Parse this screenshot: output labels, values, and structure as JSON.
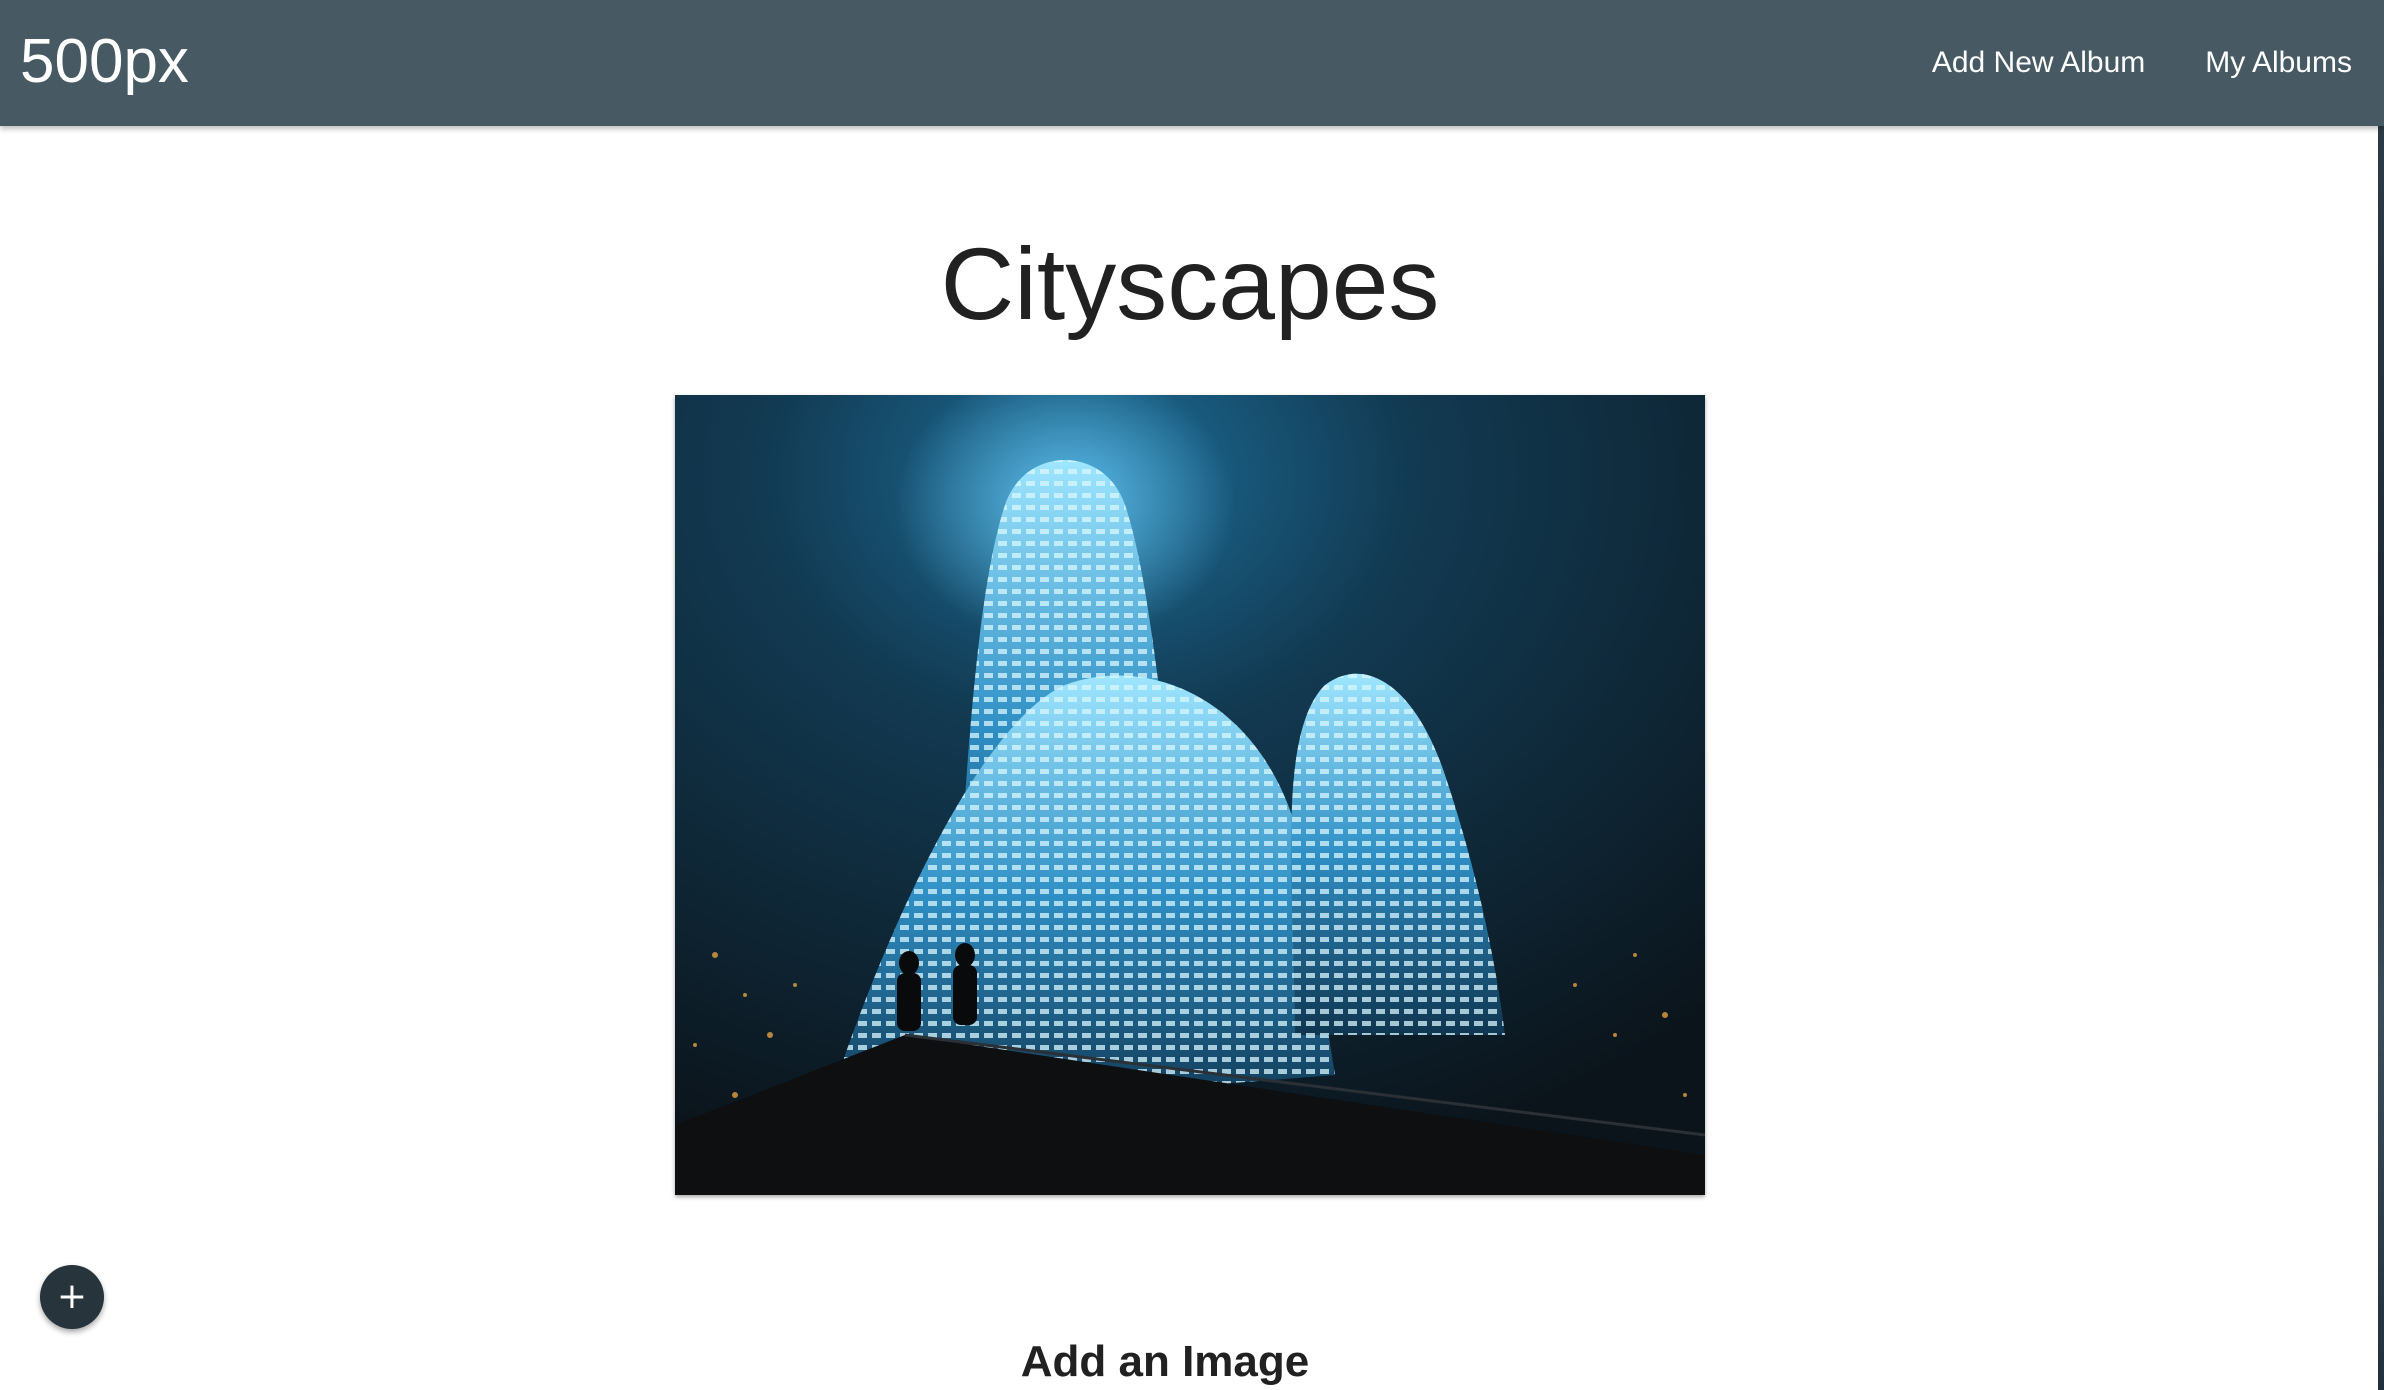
{
  "navbar": {
    "brand": "500px",
    "links": [
      "Add New Album",
      "My Albums"
    ]
  },
  "album": {
    "title": "Cityscapes"
  },
  "photo": {
    "alt": "Illuminated curved skyscrapers at night"
  },
  "fab": {
    "icon": "plus-icon",
    "symbol": "+"
  },
  "add_image": {
    "heading": "Add an Image"
  },
  "colors": {
    "navbar": "#475a63",
    "fab": "#27343b",
    "text": "#212121",
    "accent_glow": "#3fb6ff"
  }
}
